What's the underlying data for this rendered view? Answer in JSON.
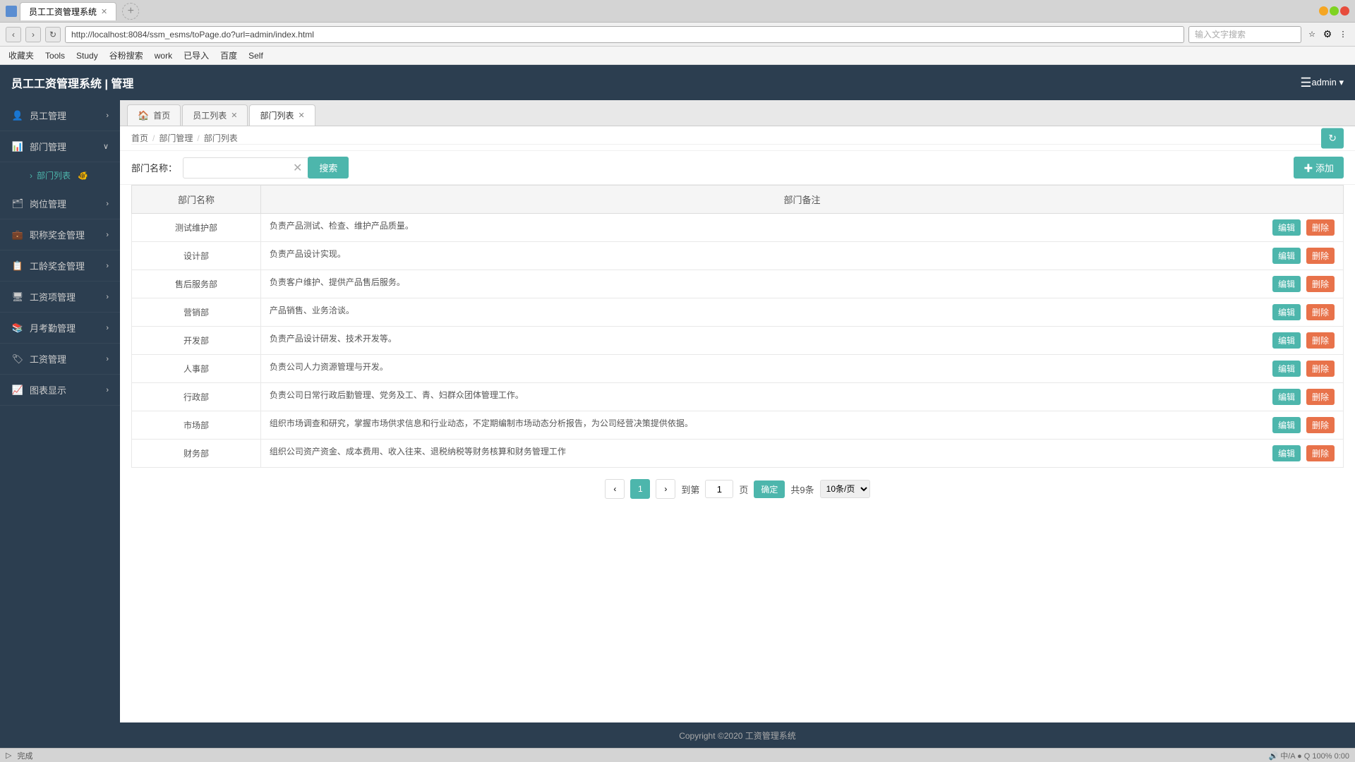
{
  "browser": {
    "title": "员工工资管理系统",
    "url": "http://localhost:8084/ssm_esms/toPage.do?url=admin/index.html",
    "search_placeholder": "输入文字搜索",
    "tab_label": "员工工资管理系统",
    "nav_back": "‹",
    "nav_forward": "›",
    "nav_refresh": "↻",
    "bookmarks": [
      {
        "label": "收藏夹"
      },
      {
        "label": "Tools"
      },
      {
        "label": "Study"
      },
      {
        "label": "谷粉搜索"
      },
      {
        "label": "work"
      },
      {
        "label": "已导入"
      },
      {
        "label": "百度"
      },
      {
        "label": "Self"
      }
    ]
  },
  "app": {
    "title": "员工工资管理系统 | 管理",
    "user": "admin ▾",
    "menu_icon": "☰"
  },
  "sidebar": {
    "items": [
      {
        "id": "employee",
        "label": "员工管理",
        "icon": "👤",
        "expanded": false
      },
      {
        "id": "dept",
        "label": "部门管理",
        "icon": "📊",
        "expanded": true
      },
      {
        "id": "dept-list",
        "label": "部门列表",
        "icon": "🐠",
        "is_sub": true,
        "active": true
      },
      {
        "id": "position",
        "label": "岗位管理",
        "icon": "🗂",
        "expanded": false
      },
      {
        "id": "salary-award",
        "label": "职称奖金管理",
        "icon": "💼",
        "expanded": false
      },
      {
        "id": "age-award",
        "label": "工龄奖金管理",
        "icon": "📋",
        "expanded": false
      },
      {
        "id": "project-salary",
        "label": "工资项管理",
        "icon": "🖥",
        "expanded": false
      },
      {
        "id": "attendance",
        "label": "月考勤管理",
        "icon": "📚",
        "expanded": false
      },
      {
        "id": "salary-mgmt",
        "label": "工资管理",
        "icon": "🏷",
        "expanded": false
      },
      {
        "id": "chart",
        "label": "图表显示",
        "icon": "📈",
        "expanded": false
      }
    ]
  },
  "tabs": [
    {
      "label": "首页",
      "icon": "🏠",
      "closable": false,
      "active": false
    },
    {
      "label": "员工列表",
      "icon": "",
      "closable": true,
      "active": false
    },
    {
      "label": "部门列表",
      "icon": "",
      "closable": true,
      "active": true
    }
  ],
  "breadcrumb": {
    "items": [
      "首页",
      "部门管理",
      "部门列表"
    ],
    "separators": [
      "/",
      "/"
    ]
  },
  "toolbar": {
    "refresh_title": "刷新",
    "search_label": "部门名称：",
    "search_placeholder": "",
    "search_btn": "搜索",
    "add_btn": "✚ 添加"
  },
  "table": {
    "columns": [
      "部门名称",
      "部门备注"
    ],
    "rows": [
      {
        "name": "测试维护部",
        "note": "负责产品测试、检查、维护产品质量。"
      },
      {
        "name": "设计部",
        "note": "负责产品设计实现。"
      },
      {
        "name": "售后服务部",
        "note": "负责客户维护、提供产品售后服务。"
      },
      {
        "name": "营销部",
        "note": "产品销售、业务洽谈。"
      },
      {
        "name": "开发部",
        "note": "负责产品设计研发、技术开发等。"
      },
      {
        "name": "人事部",
        "note": "负责公司人力资源管理与开发。"
      },
      {
        "name": "行政部",
        "note": "负责公司日常行政后勤管理、党务及工、青、妇群众团体管理工作。"
      },
      {
        "name": "市场部",
        "note": "组织市场调查和研究，掌握市场供求信息和行业动态，不定期编制市场动态分析报告，为公司经营决策提供依据。"
      },
      {
        "name": "财务部",
        "note": "组织公司资产资金、成本费用、收入往来、退税纳税等财务核算和财务管理工作"
      }
    ],
    "edit_btn": "编辑",
    "delete_btn": "删除"
  },
  "pagination": {
    "current_page": "1",
    "total": "共9条",
    "per_page": "10条/页",
    "goto_label": "到第",
    "page_label": "页",
    "confirm_label": "确定",
    "prev": "‹",
    "next": "›"
  },
  "footer": {
    "copyright": "Copyright ©2020 工资管理系统"
  },
  "status_bar": {
    "left": "▷",
    "right": "完成"
  }
}
